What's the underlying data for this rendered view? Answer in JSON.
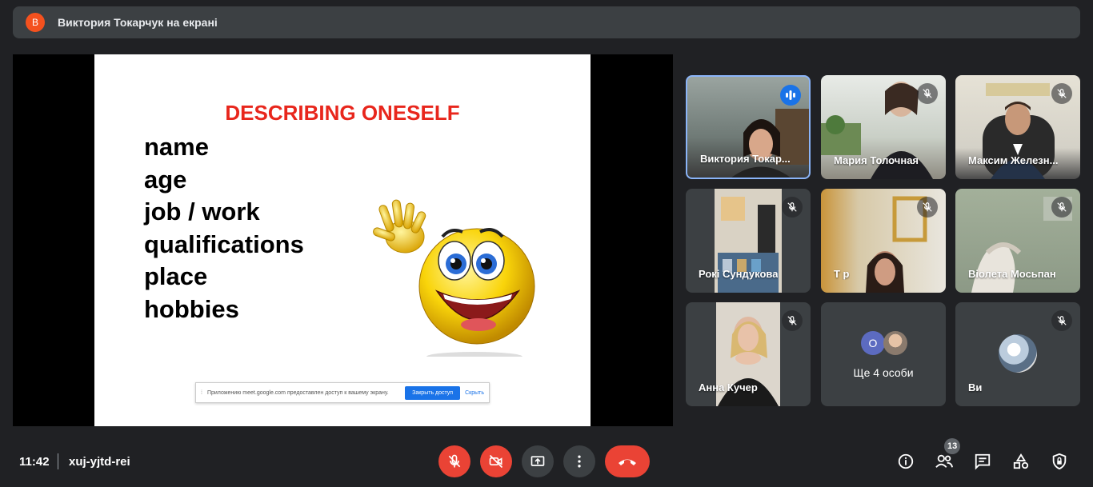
{
  "banner": {
    "avatar_letter": "В",
    "title": "Виктория Токарчук на екрані"
  },
  "slide": {
    "title": "DESCRIBING ONESELF",
    "items": [
      "name",
      "age",
      "job / work",
      "qualifications",
      "place",
      "hobbies"
    ],
    "share_bar": {
      "message": "Приложению meet.google.com предоставлен доступ к вашему экрану.",
      "stop_label": "Закрыть доступ",
      "hide_label": "Скрыть"
    }
  },
  "participants": [
    {
      "name": "Виктория Токар...",
      "mic": "speaking"
    },
    {
      "name": "Мария Толочная",
      "mic": "muted"
    },
    {
      "name": "Максим Железн...",
      "mic": "muted"
    },
    {
      "name": "Рокі Сундукова",
      "mic": "muted"
    },
    {
      "name": "Т р",
      "mic": "muted"
    },
    {
      "name": "Віолета Мосьпан",
      "mic": "muted"
    },
    {
      "name": "Анна Кучер",
      "mic": "muted"
    },
    {
      "name": "Ще 4 особи",
      "avatar_letter": "О"
    },
    {
      "name": "Ви",
      "mic": "muted"
    }
  ],
  "bottom": {
    "time": "11:42",
    "meeting_code": "xuj-yjtd-rei",
    "people_count": "13"
  },
  "colors": {
    "background": "#202124",
    "red_button": "#ea4335",
    "slide_title": "#e8261c",
    "speaking_accent": "#1a73e8"
  },
  "icons": [
    "mic-off-icon",
    "camera-off-icon",
    "present-screen-icon",
    "more-vert-icon",
    "end-call-icon",
    "info-icon",
    "people-icon",
    "chat-icon",
    "activities-icon",
    "host-controls-icon"
  ]
}
